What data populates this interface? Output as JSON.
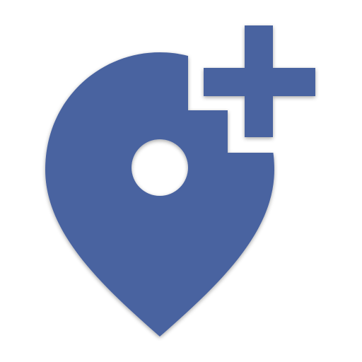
{
  "icon": {
    "name": "add-location-icon",
    "colors": {
      "fill": "#4A63A0",
      "background": "#FFFFFF"
    }
  }
}
